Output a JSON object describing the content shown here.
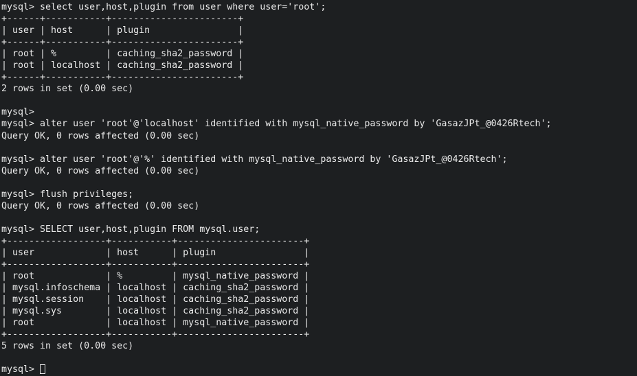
{
  "terminal": {
    "title": "mysql",
    "prompt": "mysql>",
    "background_color": "#1d1f21",
    "foreground_color": "#e9e9e9",
    "cursor": {
      "style": "hollow-block",
      "visible": true
    },
    "cols": 112,
    "rows": 32,
    "lines": [
      "mysql> select user,host,plugin from user where user='root';",
      "+------+-----------+-----------------------+",
      "| user | host      | plugin                |",
      "+------+-----------+-----------------------+",
      "| root | %         | caching_sha2_password |",
      "| root | localhost | caching_sha2_password |",
      "+------+-----------+-----------------------+",
      "2 rows in set (0.00 sec)",
      "",
      "mysql>",
      "mysql> alter user 'root'@'localhost' identified with mysql_native_password by 'GasazJPt_@0426Rtech';",
      "Query OK, 0 rows affected (0.00 sec)",
      "",
      "mysql> alter user 'root'@'%' identified with mysql_native_password by 'GasazJPt_@0426Rtech';",
      "Query OK, 0 rows affected (0.00 sec)",
      "",
      "mysql> flush privileges;",
      "Query OK, 0 rows affected (0.00 sec)",
      "",
      "mysql> SELECT user,host,plugin FROM mysql.user;",
      "+------------------+-----------+-----------------------+",
      "| user             | host      | plugin                |",
      "+------------------+-----------+-----------------------+",
      "| root             | %         | mysql_native_password |",
      "| mysql.infoschema | localhost | caching_sha2_password |",
      "| mysql.session    | localhost | caching_sha2_password |",
      "| mysql.sys        | localhost | caching_sha2_password |",
      "| root             | localhost | mysql_native_password |",
      "+------------------+-----------+-----------------------+",
      "5 rows in set (0.00 sec)",
      ""
    ],
    "last_prompt": "mysql> "
  },
  "queries": [
    {
      "statement": "select user,host,plugin from user where user='root';",
      "result_type": "table",
      "columns": [
        "user",
        "host",
        "plugin"
      ],
      "rows": [
        [
          "root",
          "%",
          "caching_sha2_password"
        ],
        [
          "root",
          "localhost",
          "caching_sha2_password"
        ]
      ],
      "status": "2 rows in set (0.00 sec)"
    },
    {
      "statement": "alter user 'root'@'localhost' identified with mysql_native_password by 'GasazJPt_@0426Rtech';",
      "result_type": "status",
      "status": "Query OK, 0 rows affected (0.00 sec)"
    },
    {
      "statement": "alter user 'root'@'%' identified with mysql_native_password by 'GasazJPt_@0426Rtech';",
      "result_type": "status",
      "status": "Query OK, 0 rows affected (0.00 sec)"
    },
    {
      "statement": "flush privileges;",
      "result_type": "status",
      "status": "Query OK, 0 rows affected (0.00 sec)"
    },
    {
      "statement": "SELECT user,host,plugin FROM mysql.user;",
      "result_type": "table",
      "columns": [
        "user",
        "host",
        "plugin"
      ],
      "rows": [
        [
          "root",
          "%",
          "mysql_native_password"
        ],
        [
          "mysql.infoschema",
          "localhost",
          "caching_sha2_password"
        ],
        [
          "mysql.session",
          "localhost",
          "caching_sha2_password"
        ],
        [
          "mysql.sys",
          "localhost",
          "caching_sha2_password"
        ],
        [
          "root",
          "localhost",
          "mysql_native_password"
        ]
      ],
      "status": "5 rows in set (0.00 sec)"
    }
  ]
}
